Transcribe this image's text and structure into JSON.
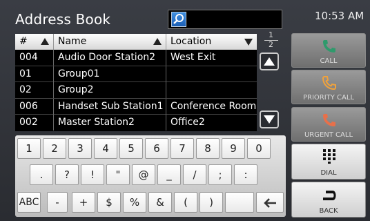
{
  "app": {
    "title": "Address Book",
    "clock": "10:53 AM"
  },
  "search": {
    "value": ""
  },
  "table": {
    "headers": {
      "number": "#",
      "name": "Name",
      "location": "Location"
    },
    "rows": [
      {
        "number": "004",
        "name": "Audio Door Station2",
        "location": "West Exit"
      },
      {
        "number": "01",
        "name": "Group01",
        "location": ""
      },
      {
        "number": "02",
        "name": "Group2",
        "location": ""
      },
      {
        "number": "006",
        "name": "Handset Sub Station1",
        "location": "Conference Room"
      },
      {
        "number": "002",
        "name": "Master Station2",
        "location": "Office2"
      }
    ],
    "page": {
      "current": "1",
      "total": "2"
    }
  },
  "keyboard": {
    "row1": [
      "1",
      "2",
      "3",
      "4",
      "5",
      "6",
      "7",
      "8",
      "9",
      "0"
    ],
    "row2": [
      ".",
      "?",
      "!",
      "\"",
      "@",
      "_",
      "/",
      ";",
      ":"
    ],
    "row3": [
      "ABC",
      "-",
      "+",
      "$",
      "%",
      "&",
      "(",
      ")",
      "",
      ""
    ]
  },
  "actions": {
    "call": "CALL",
    "priority_call": "PRIORITY CALL",
    "urgent_call": "URGENT CALL",
    "dial": "DIAL",
    "back": "BACK"
  },
  "colors": {
    "call_icon": "#2f9a6c",
    "priority_icon": "#f0a23c",
    "urgent_icon": "#e8704a",
    "search_icon": "#2f78cf"
  }
}
